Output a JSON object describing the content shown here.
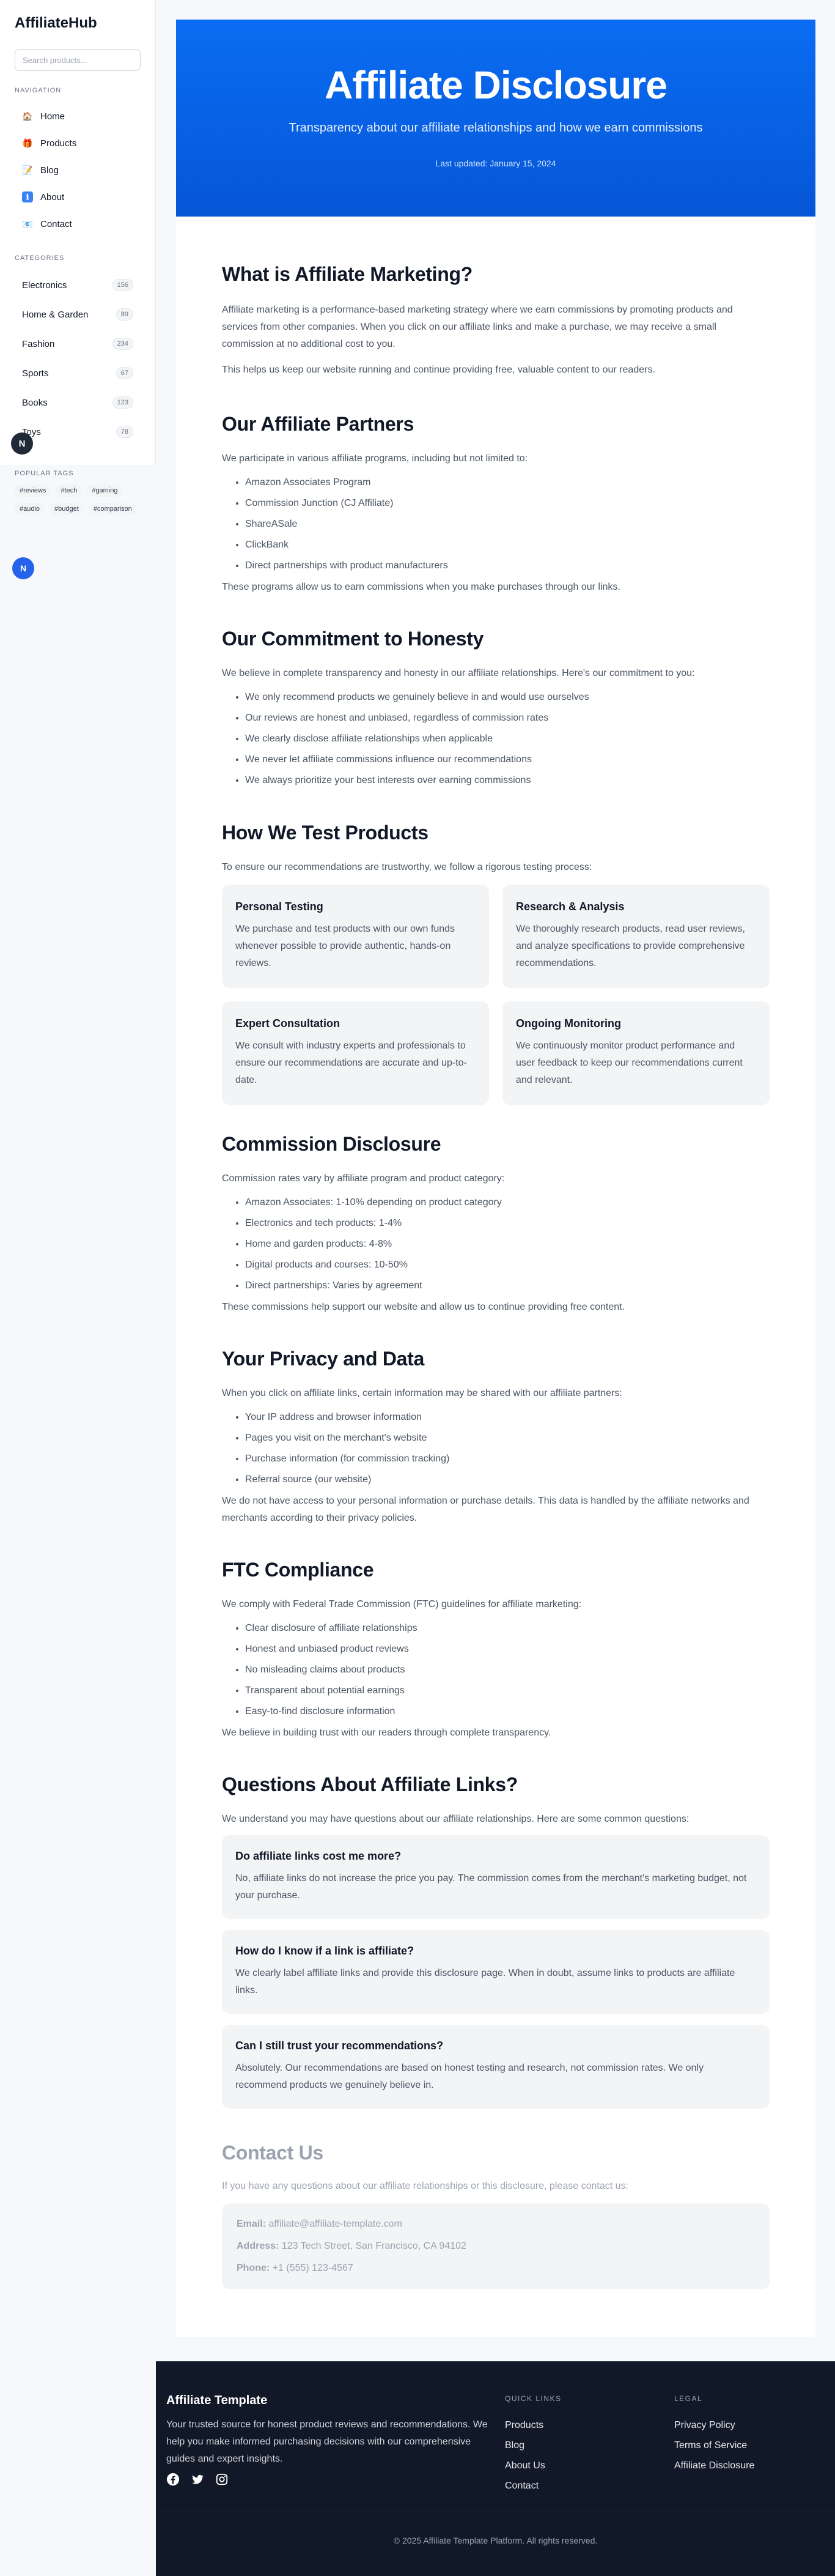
{
  "brand": "AffiliateHub",
  "search": {
    "placeholder": "Search products..."
  },
  "navigation": {
    "title": "NAVIGATION",
    "items": [
      {
        "label": "Home",
        "icon": "home-icon",
        "glyph": "🏠"
      },
      {
        "label": "Products",
        "icon": "gift-icon",
        "glyph": "🎁"
      },
      {
        "label": "Blog",
        "icon": "memo-icon",
        "glyph": "📝"
      },
      {
        "label": "About",
        "icon": "info-icon",
        "glyph": "ℹ"
      },
      {
        "label": "Contact",
        "icon": "email-icon",
        "glyph": "📧"
      }
    ]
  },
  "categories": {
    "title": "CATEGORIES",
    "items": [
      {
        "label": "Electronics",
        "count": "156"
      },
      {
        "label": "Home & Garden",
        "count": "89"
      },
      {
        "label": "Fashion",
        "count": "234"
      },
      {
        "label": "Sports",
        "count": "67"
      },
      {
        "label": "Books",
        "count": "123"
      },
      {
        "label": "Toys",
        "count": "78"
      }
    ]
  },
  "tags": {
    "title": "POPULAR TAGS",
    "items": [
      "#reviews",
      "#tech",
      "#gaming",
      "#audio",
      "#budget",
      "#comparison"
    ]
  },
  "avatar_dark": "N",
  "avatar_blue": "N",
  "hero": {
    "title": "Affiliate Disclosure",
    "subtitle": "Transparency about our affiliate relationships and how we earn commissions",
    "date": "Last updated: January 15, 2024"
  },
  "sections": {
    "what": {
      "title": "What is Affiliate Marketing?",
      "p1": "Affiliate marketing is a performance-based marketing strategy where we earn commissions by promoting products and services from other companies. When you click on our affiliate links and make a purchase, we may receive a small commission at no additional cost to you.",
      "p2": "This helps us keep our website running and continue providing free, valuable content to our readers."
    },
    "partners": {
      "title": "Our Affiliate Partners",
      "intro": "We participate in various affiliate programs, including but not limited to:",
      "items": [
        "Amazon Associates Program",
        "Commission Junction (CJ Affiliate)",
        "ShareASale",
        "ClickBank",
        "Direct partnerships with product manufacturers"
      ],
      "outro": "These programs allow us to earn commissions when you make purchases through our links."
    },
    "honesty": {
      "title": "Our Commitment to Honesty",
      "intro": "We believe in complete transparency and honesty in our affiliate relationships. Here's our commitment to you:",
      "items": [
        "We only recommend products we genuinely believe in and would use ourselves",
        "Our reviews are honest and unbiased, regardless of commission rates",
        "We clearly disclose affiliate relationships when applicable",
        "We never let affiliate commissions influence our recommendations",
        "We always prioritize your best interests over earning commissions"
      ]
    },
    "testing": {
      "title": "How We Test Products",
      "intro": "To ensure our recommendations are trustworthy, we follow a rigorous testing process:",
      "cards": [
        {
          "title": "Personal Testing",
          "text": "We purchase and test products with our own funds whenever possible to provide authentic, hands-on reviews."
        },
        {
          "title": "Research & Analysis",
          "text": "We thoroughly research products, read user reviews, and analyze specifications to provide comprehensive recommendations."
        },
        {
          "title": "Expert Consultation",
          "text": "We consult with industry experts and professionals to ensure our recommendations are accurate and up-to-date."
        },
        {
          "title": "Ongoing Monitoring",
          "text": "We continuously monitor product performance and user feedback to keep our recommendations current and relevant."
        }
      ]
    },
    "commission": {
      "title": "Commission Disclosure",
      "intro": "Commission rates vary by affiliate program and product category:",
      "items": [
        "Amazon Associates: 1-10% depending on product category",
        "Electronics and tech products: 1-4%",
        "Home and garden products: 4-8%",
        "Digital products and courses: 10-50%",
        "Direct partnerships: Varies by agreement"
      ],
      "outro": "These commissions help support our website and allow us to continue providing free content."
    },
    "privacy": {
      "title": "Your Privacy and Data",
      "intro": "When you click on affiliate links, certain information may be shared with our affiliate partners:",
      "items": [
        "Your IP address and browser information",
        "Pages you visit on the merchant's website",
        "Purchase information (for commission tracking)",
        "Referral source (our website)"
      ],
      "outro": "We do not have access to your personal information or purchase details. This data is handled by the affiliate networks and merchants according to their privacy policies."
    },
    "ftc": {
      "title": "FTC Compliance",
      "intro": "We comply with Federal Trade Commission (FTC) guidelines for affiliate marketing:",
      "items": [
        "Clear disclosure of affiliate relationships",
        "Honest and unbiased product reviews",
        "No misleading claims about products",
        "Transparent about potential earnings",
        "Easy-to-find disclosure information"
      ],
      "outro": "We believe in building trust with our readers through complete transparency."
    },
    "questions": {
      "title": "Questions About Affiliate Links?",
      "intro": "We understand you may have questions about our affiliate relationships. Here are some common questions:",
      "faqs": [
        {
          "q": "Do affiliate links cost me more?",
          "a": "No, affiliate links do not increase the price you pay. The commission comes from the merchant's marketing budget, not your purchase."
        },
        {
          "q": "How do I know if a link is affiliate?",
          "a": "We clearly label affiliate links and provide this disclosure page. When in doubt, assume links to products are affiliate links."
        },
        {
          "q": "Can I still trust your recommendations?",
          "a": "Absolutely. Our recommendations are based on honest testing and research, not commission rates. We only recommend products we genuinely believe in."
        }
      ]
    },
    "contact": {
      "title": "Contact Us",
      "intro": "If you have any questions about our affiliate relationships or this disclosure, please contact us:",
      "email_label": "Email:",
      "email": "affiliate@affiliate-template.com",
      "address_label": "Address:",
      "address": "123 Tech Street, San Francisco, CA 94102",
      "phone_label": "Phone:",
      "phone": "+1 (555) 123-4567"
    }
  },
  "footer": {
    "title": "Affiliate Template",
    "desc": "Your trusted source for honest product reviews and recommendations. We help you make informed purchasing decisions with our comprehensive guides and expert insights.",
    "quick_links": {
      "title": "QUICK LINKS",
      "items": [
        "Products",
        "Blog",
        "About Us",
        "Contact"
      ]
    },
    "legal": {
      "title": "LEGAL",
      "items": [
        "Privacy Policy",
        "Terms of Service",
        "Affiliate Disclosure"
      ]
    },
    "copyright": "© 2025 Affiliate Template Platform. All rights reserved."
  },
  "colors": {
    "hero": "#0a6df3",
    "footer": "#111827",
    "accent": "#2563eb"
  }
}
